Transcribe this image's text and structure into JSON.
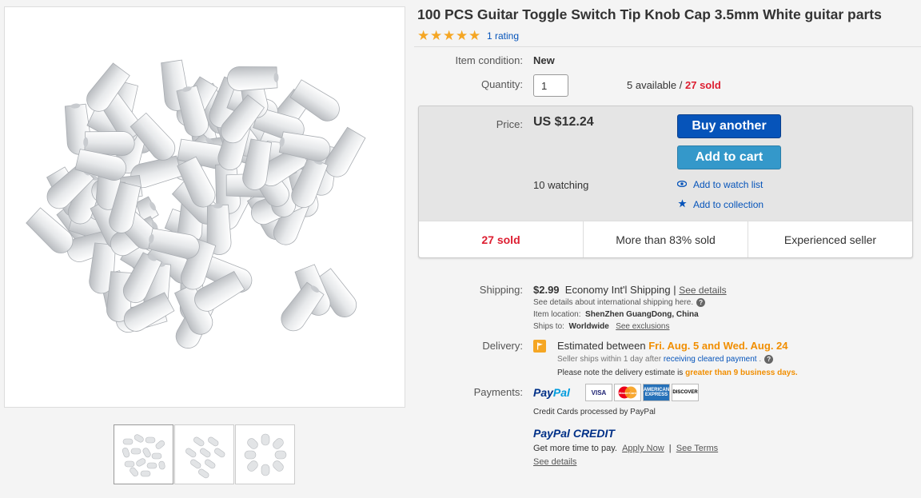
{
  "title": "100 PCS Guitar Toggle Switch Tip Knob Cap 3.5mm White guitar parts",
  "rating": {
    "stars": 5,
    "link": "1 rating",
    "star_glyph": "★"
  },
  "condition": {
    "label": "Item condition:",
    "value": "New"
  },
  "quantity": {
    "label": "Quantity:",
    "value": "1",
    "available": "5 available",
    "sep": " / ",
    "sold": "27 sold"
  },
  "price": {
    "label": "Price:",
    "value": "US $12.24"
  },
  "buttons": {
    "buy": "Buy another",
    "cart": "Add to cart"
  },
  "watching": "10 watching",
  "links": {
    "watch": "Add to watch list",
    "collection": "Add to collection"
  },
  "stats": [
    "27 sold",
    "More than 83% sold",
    "Experienced seller"
  ],
  "shipping": {
    "label": "Shipping:",
    "cost": "$2.99",
    "method": "Economy Int'l Shipping",
    "sep": " | ",
    "details_link": "See details",
    "intl_note": "See details about international shipping here.",
    "location_label": "Item location:",
    "location": "ShenZhen GuangDong, China",
    "ships_label": "Ships to:",
    "ships_to": "Worldwide",
    "exclusions_link": "See exclusions"
  },
  "delivery": {
    "label": "Delivery:",
    "prefix": "Estimated between ",
    "dates": "Fri. Aug. 5 and Wed. Aug. 24",
    "ships_note": "Seller ships within 1 day after ",
    "cleared_link": "receiving cleared payment",
    "period": " .",
    "note_prefix": "Please note the delivery estimate is ",
    "note_highlight": "greater than 9 business days."
  },
  "payments": {
    "label": "Payments:",
    "paypal_a": "Pay",
    "paypal_b": "Pal",
    "cards": [
      "VISA",
      "MasterCard",
      "AMERICAN EXPRESS",
      "DISCOVER"
    ],
    "credit_note": "Credit Cards processed by PayPal",
    "credit_a": "PayPal",
    "credit_b": " CREDIT",
    "more_time": "Get more time to pay.",
    "apply": "Apply Now",
    "pipe": "|",
    "terms": "See Terms",
    "see_details": "See details"
  },
  "colors": {
    "link": "#0654ba",
    "buy": "#0654ba",
    "cart": "#3498ca",
    "red": "#dd1e31",
    "orange": "#f18e00"
  }
}
